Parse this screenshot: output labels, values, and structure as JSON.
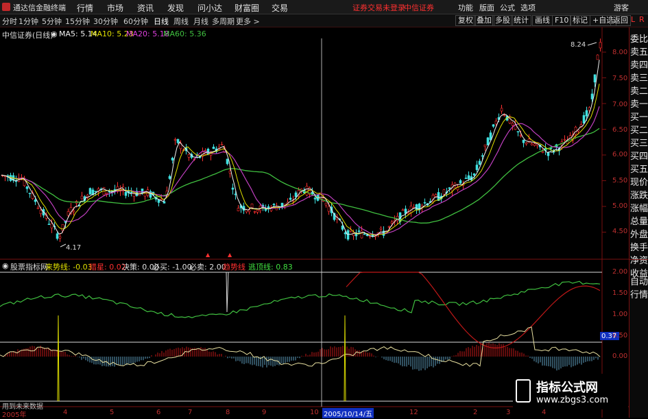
{
  "app": {
    "title": "通达信金融终端"
  },
  "menu": {
    "items": [
      "行情",
      "市场",
      "资讯",
      "发现",
      "问小达",
      "财富圈",
      "交易"
    ]
  },
  "status": {
    "warn1": "证券交易未登录",
    "warn2": "中信证券"
  },
  "right_menu": {
    "items": [
      "功能",
      "版面",
      "公式",
      "选项"
    ],
    "guest": "游客"
  },
  "toolbar": {
    "periods": [
      "分时",
      "1分钟",
      "5分钟",
      "15分钟",
      "30分钟",
      "60分钟",
      "日线",
      "周线",
      "月线",
      "多周期",
      "更多 >"
    ],
    "active": "日线",
    "right_items": [
      "复权",
      "叠加",
      "多股",
      "统计",
      "画线",
      "F10",
      "标记",
      "+自选",
      "返回"
    ]
  },
  "chart_header": {
    "stock": "中信证券(日线)",
    "ma5": "MA5: 5.14",
    "ma10": "MA10: 5.23",
    "ma20": "MA20: 5.18",
    "ma60": "MA60: 5.36"
  },
  "price_axis": {
    "ticks": [
      "8.00",
      "7.50",
      "7.00",
      "6.50",
      "6.00",
      "5.50",
      "5.00",
      "4.50"
    ]
  },
  "annotations": {
    "high": "8.24",
    "low": "4.17"
  },
  "indicator": {
    "name": "股票指标网",
    "items": [
      {
        "label": "来势线: -0.03",
        "color": "#e0e000"
      },
      {
        "label": "猎星: 0.02",
        "color": "#ff3030"
      },
      {
        "label": "决策: 0.00",
        "color": "#e0e0e0"
      },
      {
        "label": "必买: -1.00",
        "color": "#e0e0e0"
      },
      {
        "label": "必卖: 2.00",
        "color": "#e0e0e0"
      },
      {
        "label": "趋势线",
        "color": "#ff3030"
      },
      {
        "label": "逃顶线: 0.83",
        "color": "#40e040"
      }
    ],
    "axis": [
      "2.00",
      "1.50",
      "1.00",
      "0.50",
      "0.00"
    ],
    "marker": "0.37"
  },
  "xaxis": {
    "ticks": [
      "2005年",
      "4",
      "5",
      "6",
      "7",
      "8",
      "9",
      "10",
      "2005/10/14/五",
      "12",
      "2",
      "3",
      "4"
    ]
  },
  "bottom_note": "用到未来数据",
  "sidebar": {
    "items": [
      "委比",
      "卖五",
      "卖四",
      "卖三",
      "卖二",
      "卖一",
      "买一",
      "买二",
      "买三",
      "买四",
      "买五",
      "现价",
      "涨跌",
      "涨幅",
      "总量",
      "外盘",
      "换手",
      "净资",
      "收益"
    ],
    "bottom": [
      "自动",
      "行情"
    ]
  },
  "watermark": {
    "line1": "指标公式网",
    "line2": "www.zbgs3.com"
  },
  "colors": {
    "up": "#ff3030",
    "down": "#40e0e0",
    "ma5": "#ffffff",
    "ma10": "#e0e000",
    "ma20": "#e040e0",
    "ma60": "#40c040",
    "axis": "#7a1010"
  }
}
